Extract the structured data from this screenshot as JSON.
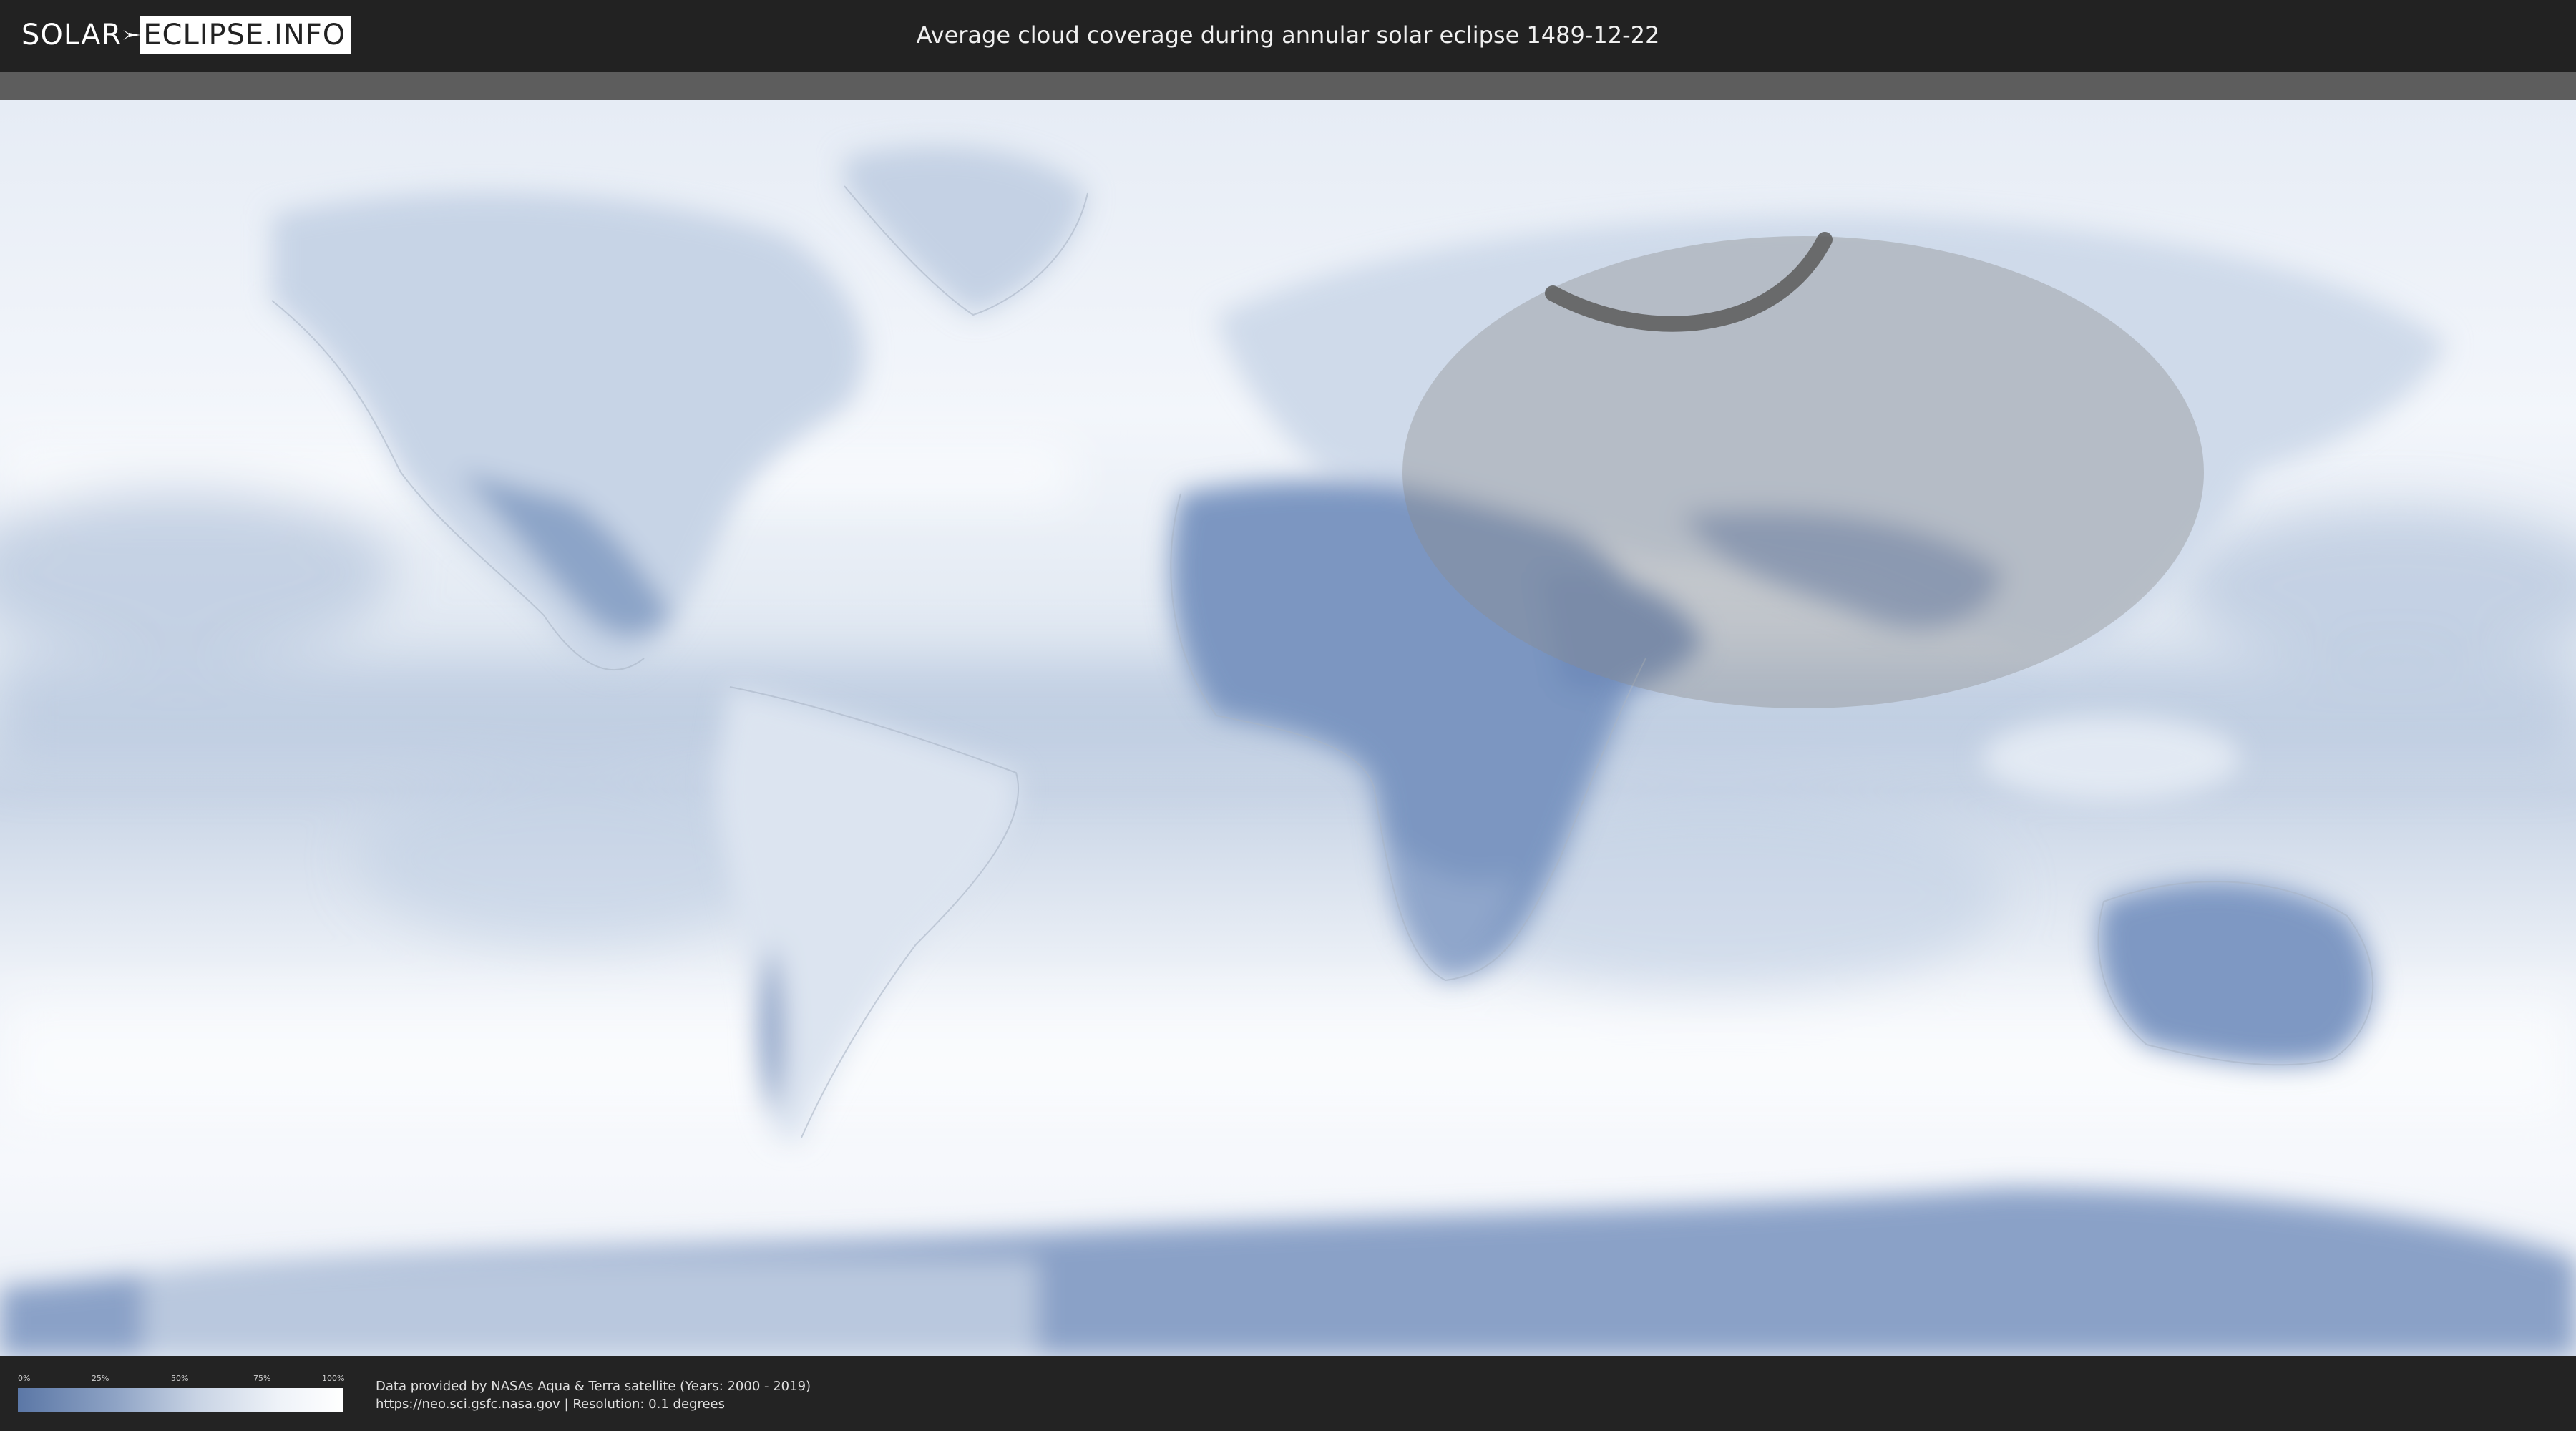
{
  "header": {
    "logo_left": "SOLAR",
    "logo_right": "ECLIPSE.INFO",
    "title": "Average cloud coverage during annular solar eclipse 1489-12-22"
  },
  "legend": {
    "ticks": [
      "0%",
      "25%",
      "50%",
      "75%",
      "100%"
    ],
    "colors": {
      "low": "#5b77a6",
      "high": "#ffffff"
    }
  },
  "source": {
    "line1": "Data provided by NASAs Aqua & Terra satellite (Years: 2000 - 2019)",
    "line2": "https://neo.sci.gsfc.nasa.gov | Resolution: 0.1 degrees"
  },
  "map": {
    "projection": "equirectangular world map",
    "layer": "average cloud coverage",
    "colors": {
      "ocean_cloud": "#eef3f9",
      "clear_land": "#7f98c2",
      "eclipse_zone": "#9a9a9a",
      "path": "#555555"
    }
  }
}
